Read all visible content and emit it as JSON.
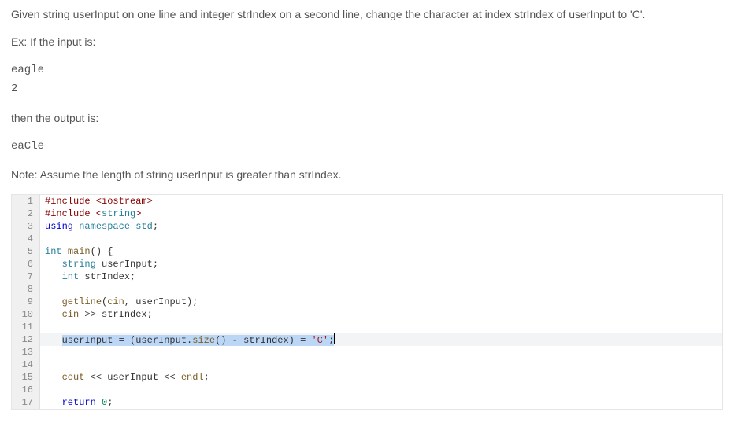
{
  "problem": {
    "statement": "Given string userInput on one line and integer strIndex on a second line, change the character at index strIndex of userInput to 'C'.",
    "example_lead": "Ex: If the input is:",
    "example_input_line1": "eagle",
    "example_input_line2": "2",
    "output_lead": "then the output is:",
    "example_output": "eaCle",
    "note": "Note: Assume the length of string userInput is greater than strIndex."
  },
  "code": {
    "lines": [
      "#include <iostream>",
      "#include <string>",
      "using namespace std;",
      "",
      "int main() {",
      "   string userInput;",
      "   int strIndex;",
      "",
      "   getline(cin, userInput);",
      "   cin >> strIndex;",
      "",
      "   userInput = (userInput.size() - strIndex) = 'C';",
      "",
      "",
      "   cout << userInput << endl;",
      "",
      "   return 0;"
    ],
    "highlight_line": 12,
    "selection_text": "userInput = (userInput.size() - strIndex) = 'C';"
  }
}
